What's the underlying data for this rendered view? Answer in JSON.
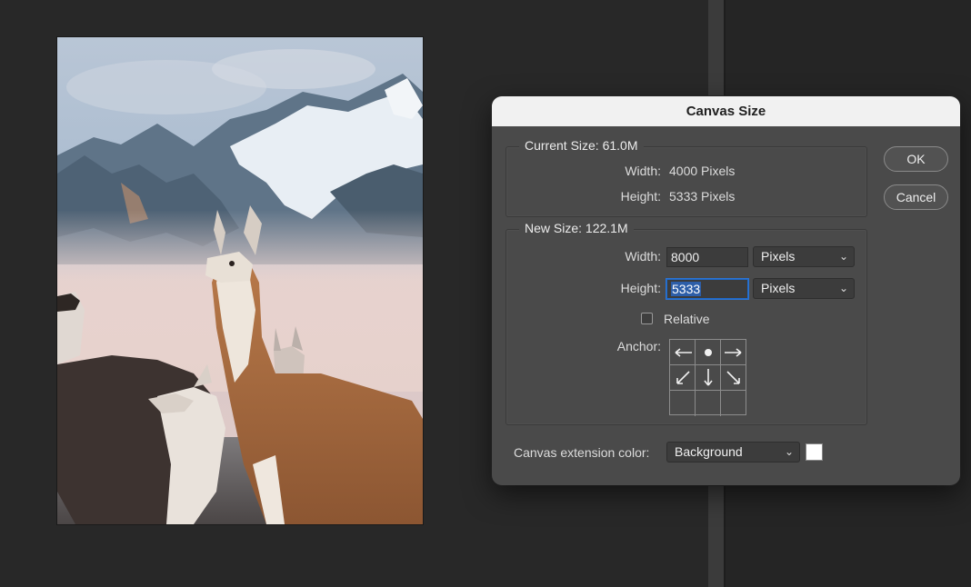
{
  "dialog": {
    "title": "Canvas Size",
    "ok_label": "OK",
    "cancel_label": "Cancel",
    "current": {
      "heading": "Current Size: 61.0M",
      "width_label": "Width:",
      "width_value": "4000 Pixels",
      "height_label": "Height:",
      "height_value": "5333 Pixels"
    },
    "new": {
      "heading": "New Size: 122.1M",
      "width_label": "Width:",
      "width_value": "8000",
      "width_unit": "Pixels",
      "height_label": "Height:",
      "height_value": "5333",
      "height_unit": "Pixels",
      "relative_label": "Relative",
      "relative_checked": false,
      "anchor_label": "Anchor:"
    },
    "extension": {
      "label": "Canvas extension color:",
      "value": "Background",
      "swatch_color": "#ffffff"
    }
  },
  "colors": {
    "dialog_bg": "#4a4a4a",
    "titlebar_bg": "#f1f1f1",
    "focus_blue": "#2b74d4",
    "workspace_bg": "#282828"
  },
  "icons": {
    "anchor_cells": [
      "arrow-left-icon",
      "dot-icon",
      "arrow-right-icon",
      "arrow-down-left-icon",
      "arrow-down-icon",
      "arrow-down-right-icon",
      "",
      "",
      ""
    ]
  }
}
